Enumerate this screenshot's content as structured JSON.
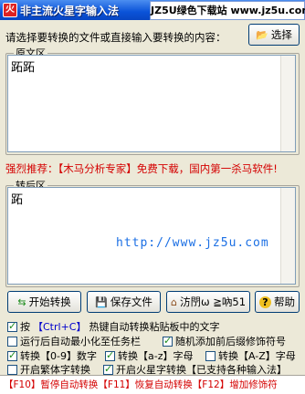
{
  "window": {
    "title": "非主流火星字输入法",
    "site_banner": "JZ5U绿色下载站 www.jz5u.com"
  },
  "prompt": "请选择要转换的文件或直接输入要转换的内容：",
  "choose_button": "选择",
  "source": {
    "legend": "原文区",
    "text": "跖跖"
  },
  "promo": "强烈推荐：【木马分析专家】免费下载，国内第一杀马软件!",
  "target": {
    "legend": "转后区",
    "text": "跖",
    "watermark_url": "http://www.jz5u.com"
  },
  "buttons": {
    "convert": "开始转换",
    "save": "保存文件",
    "visit": "汸閅ω ≧吶51",
    "help": "帮助"
  },
  "options": {
    "hotkey_prefix": "按",
    "hotkey_key": "【Ctrl+C】",
    "hotkey_suffix": "热键自动转换粘贴板中的文字",
    "minimize_tray": "运行后自动最小化至任务栏",
    "random_decor": "随机添加前后缀修饰符号",
    "convert_digits": "转换【0-9】数字",
    "convert_lower": "转换【a-z】字母",
    "convert_upper": "转换【A-Z】字母",
    "traditional": "开启繁体字转换",
    "martian": "开启火星字转换【已支持各种输入法】"
  },
  "footer": "【F10】暂停自动转换【F11】恢复自动转换【F12】增加修饰符",
  "icons": {
    "app": "app-icon",
    "folder": "folder-open-icon",
    "convert": "arrows-icon",
    "save": "save-icon",
    "home": "home-icon",
    "help": "question-icon"
  },
  "colors": {
    "title_bar": "#0a52d8",
    "promo_red": "#d40000",
    "url_blue": "#1b6fe4"
  }
}
